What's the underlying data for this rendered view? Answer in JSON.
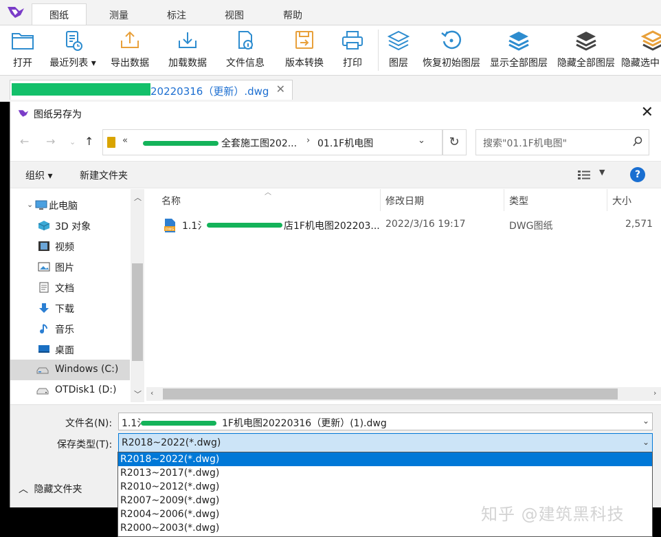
{
  "app": {
    "menu_tabs": [
      "图纸",
      "测量",
      "标注",
      "视图",
      "帮助"
    ],
    "active_tab": "图纸",
    "ribbon": [
      {
        "label": "打开",
        "icon": "folder-open-icon"
      },
      {
        "label": "最近列表",
        "icon": "recent-list-icon",
        "has_dropdown": true
      },
      {
        "label": "导出数据",
        "icon": "export-icon"
      },
      {
        "label": "加载数据",
        "icon": "load-icon"
      },
      {
        "label": "文件信息",
        "icon": "file-info-icon"
      },
      {
        "label": "版本转换",
        "icon": "version-convert-icon"
      },
      {
        "label": "打印",
        "icon": "printer-icon"
      },
      {
        "label": "图层",
        "icon": "layers-icon"
      },
      {
        "label": "恢复初始图层",
        "icon": "restore-layers-icon"
      },
      {
        "label": "显示全部图层",
        "icon": "show-all-layers-icon"
      },
      {
        "label": "隐藏全部图层",
        "icon": "hide-all-layers-icon"
      },
      {
        "label": "隐藏选中",
        "icon": "hide-selected-icon"
      }
    ],
    "doc_tab": {
      "title": "20220316（更新）.dwg",
      "close": "✕"
    },
    "colors": {
      "accent": "#1d6fd1",
      "icon_blue": "#2d8ccf",
      "icon_orange": "#e8a03a",
      "select_blue": "#0078d7"
    }
  },
  "dialog": {
    "title": "图纸另存为",
    "close": "✕",
    "address": {
      "prefix": "«",
      "crumb1": "全套施工图202...",
      "separator": "›",
      "crumb2": "01.1F机电图"
    },
    "search_placeholder": "搜索\"01.1F机电图\"",
    "toolbar": {
      "organize": "组织 ▾",
      "new_folder": "新建文件夹"
    },
    "nav_items": [
      {
        "label": "此电脑",
        "icon": "computer-icon"
      },
      {
        "label": "3D 对象",
        "icon": "3d-objects-icon"
      },
      {
        "label": "视频",
        "icon": "video-icon"
      },
      {
        "label": "图片",
        "icon": "pictures-icon"
      },
      {
        "label": "文档",
        "icon": "documents-icon"
      },
      {
        "label": "下载",
        "icon": "download-icon"
      },
      {
        "label": "音乐",
        "icon": "music-icon"
      },
      {
        "label": "桌面",
        "icon": "desktop-icon"
      },
      {
        "label": "Windows (C:)",
        "icon": "drive-icon",
        "selected": true
      },
      {
        "label": "OTDisk1 (D:)",
        "icon": "drive-icon"
      }
    ],
    "columns": [
      "名称",
      "修改日期",
      "类型",
      "大小"
    ],
    "files": [
      {
        "name_prefix": "1.1氵",
        "name_suffix": "店1F机电图202203...",
        "date": "2022/3/16 19:17",
        "type": "DWG图纸",
        "size": "2,571"
      }
    ],
    "filename": {
      "label": "文件名(N):",
      "prefix": "1.1氵",
      "suffix": "1F机电图20220316（更新）(1).dwg"
    },
    "save_type": {
      "label": "保存类型(T):",
      "value": "R2018~2022(*.dwg)"
    },
    "save_type_options": [
      "R2018~2022(*.dwg)",
      "R2013~2017(*.dwg)",
      "R2010~2012(*.dwg)",
      "R2007~2009(*.dwg)",
      "R2004~2006(*.dwg)",
      "R2000~2003(*.dwg)"
    ],
    "hide_folders": "隐藏文件夹"
  },
  "watermark": "知乎 @建筑黑科技"
}
